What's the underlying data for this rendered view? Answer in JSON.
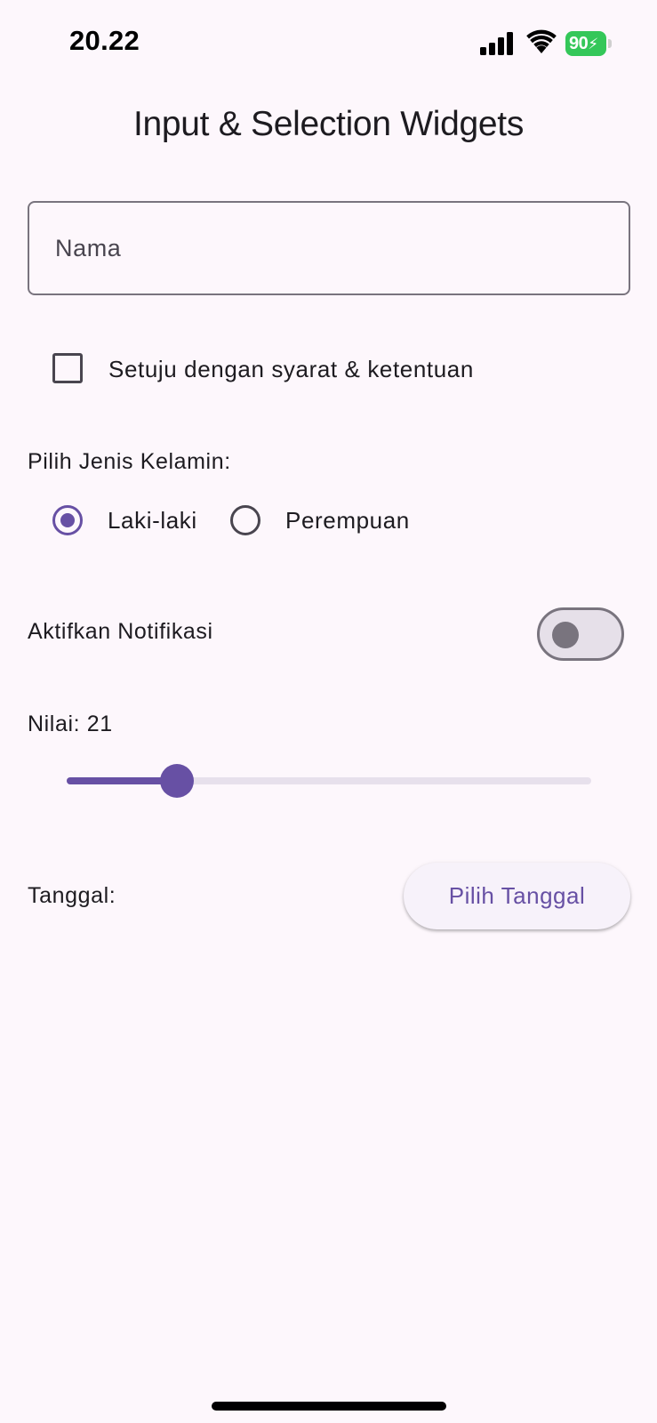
{
  "status_bar": {
    "time": "20.22",
    "battery": "90",
    "icons": [
      "signal-icon",
      "wifi-icon",
      "battery-icon",
      "charging-icon"
    ]
  },
  "app_bar": {
    "title": "Input & Selection Widgets"
  },
  "name_field": {
    "placeholder": "Nama",
    "value": ""
  },
  "agreement_checkbox": {
    "label": "Setuju dengan syarat & ketentuan",
    "checked": false
  },
  "gender": {
    "label": "Pilih Jenis Kelamin:",
    "options": [
      {
        "label": "Laki-laki",
        "selected": true
      },
      {
        "label": "Perempuan",
        "selected": false
      }
    ]
  },
  "notification": {
    "label": "Aktifkan Notifikasi",
    "enabled": false
  },
  "slider": {
    "label": "Nilai: 21",
    "value": 21,
    "min": 0,
    "max": 100
  },
  "date": {
    "label": "Tanggal:",
    "button_label": "Pilih Tanggal"
  },
  "colors": {
    "primary": "#6750a4",
    "background": "#fdf7fc",
    "outline": "#79747e",
    "battery": "#34c759"
  }
}
